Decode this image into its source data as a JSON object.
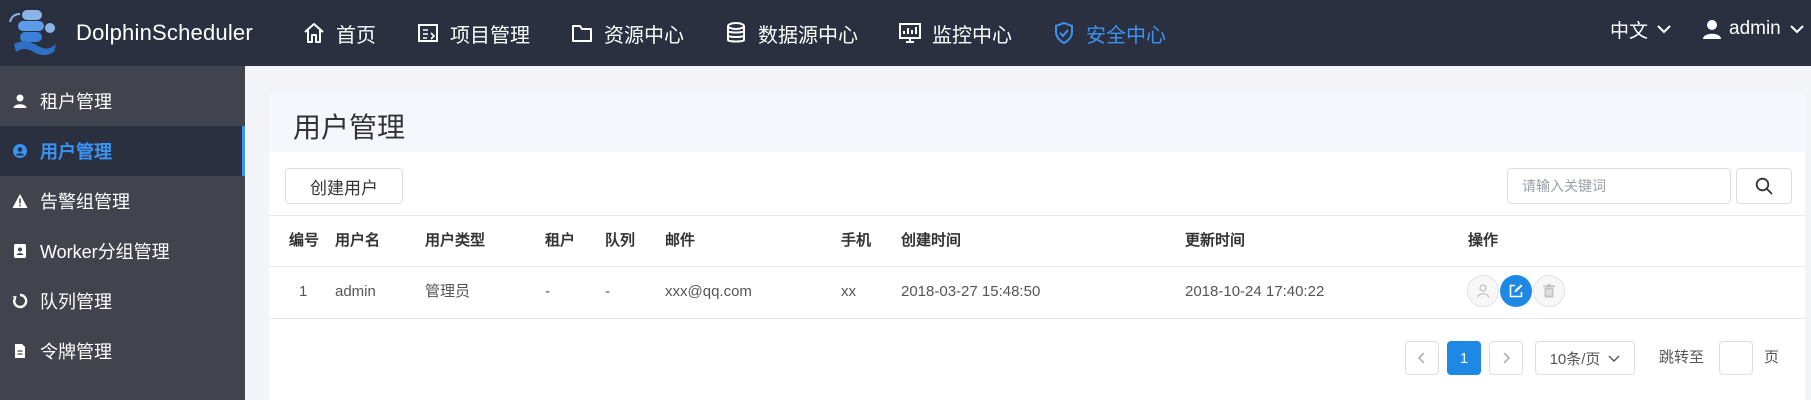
{
  "app": {
    "name": "DolphinScheduler"
  },
  "nav": {
    "items": [
      {
        "label": "首页",
        "icon": "home-icon"
      },
      {
        "label": "项目管理",
        "icon": "project-icon"
      },
      {
        "label": "资源中心",
        "icon": "folder-icon"
      },
      {
        "label": "数据源中心",
        "icon": "database-icon"
      },
      {
        "label": "监控中心",
        "icon": "monitor-icon"
      },
      {
        "label": "安全中心",
        "icon": "shield-icon",
        "active": true
      }
    ],
    "language": "中文",
    "username": "admin"
  },
  "sidebar": {
    "items": [
      {
        "label": "租户管理",
        "icon": "user-icon"
      },
      {
        "label": "用户管理",
        "icon": "user-circle-icon",
        "active": true
      },
      {
        "label": "告警组管理",
        "icon": "warning-icon"
      },
      {
        "label": "Worker分组管理",
        "icon": "id-card-icon"
      },
      {
        "label": "队列管理",
        "icon": "recycle-icon"
      },
      {
        "label": "令牌管理",
        "icon": "file-icon"
      }
    ]
  },
  "main": {
    "title": "用户管理",
    "create_button": "创建用户",
    "search_placeholder": "请输入关键词",
    "table": {
      "columns": [
        "编号",
        "用户名",
        "用户类型",
        "租户",
        "队列",
        "邮件",
        "手机",
        "创建时间",
        "更新时间",
        "操作"
      ],
      "rows": [
        [
          "1",
          "admin",
          "管理员",
          "-",
          "-",
          "xxx@qq.com",
          "xx",
          "2018-03-27 15:48:50",
          "2018-10-24 17:40:22"
        ]
      ]
    },
    "pagination": {
      "current_page": "1",
      "page_size": "10条/页",
      "jump_label": "跳转至",
      "page_unit": "页"
    }
  },
  "colors": {
    "topbar": "#2b3041",
    "sidebar": "#41444d",
    "accent": "#3b93f2",
    "primary_button": "#1e88e5"
  }
}
